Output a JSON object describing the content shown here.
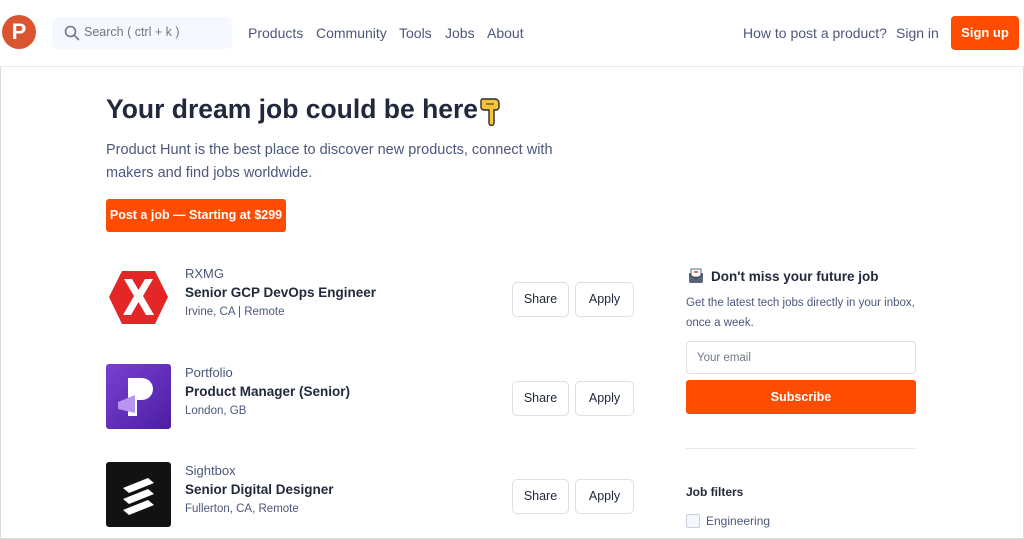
{
  "header": {
    "logo_letter": "P",
    "search_placeholder": "Search ( ctrl + k )",
    "nav": [
      "Products",
      "Community",
      "Tools",
      "Jobs",
      "About"
    ],
    "how_to_post": "How to post a product?",
    "sign_in": "Sign in",
    "sign_up": "Sign up"
  },
  "hero": {
    "title": "Your dream job could be here",
    "subtitle": "Product Hunt is the best place to discover new products, connect with makers and find jobs worldwide.",
    "post_button": "Post a job — Starting at $299"
  },
  "jobs": [
    {
      "company": "RXMG",
      "title": "Senior GCP DevOps Engineer",
      "location": "Irvine, CA | Remote",
      "share": "Share",
      "apply": "Apply"
    },
    {
      "company": "Portfolio",
      "title": "Product Manager (Senior)",
      "location": "London, GB",
      "share": "Share",
      "apply": "Apply"
    },
    {
      "company": "Sightbox",
      "title": "Senior Digital Designer",
      "location": "Fullerton, CA, Remote",
      "share": "Share",
      "apply": "Apply"
    }
  ],
  "sidebar": {
    "title": "Don't miss your future job",
    "description": "Get the latest tech jobs directly in your inbox, once a week.",
    "email_placeholder": "Your email",
    "subscribe": "Subscribe",
    "filters_title": "Job filters",
    "filters": [
      "Engineering"
    ]
  },
  "colors": {
    "accent": "#fe4c03",
    "logo": "#da552f",
    "text": "#21293c",
    "muted": "#4b587c"
  }
}
